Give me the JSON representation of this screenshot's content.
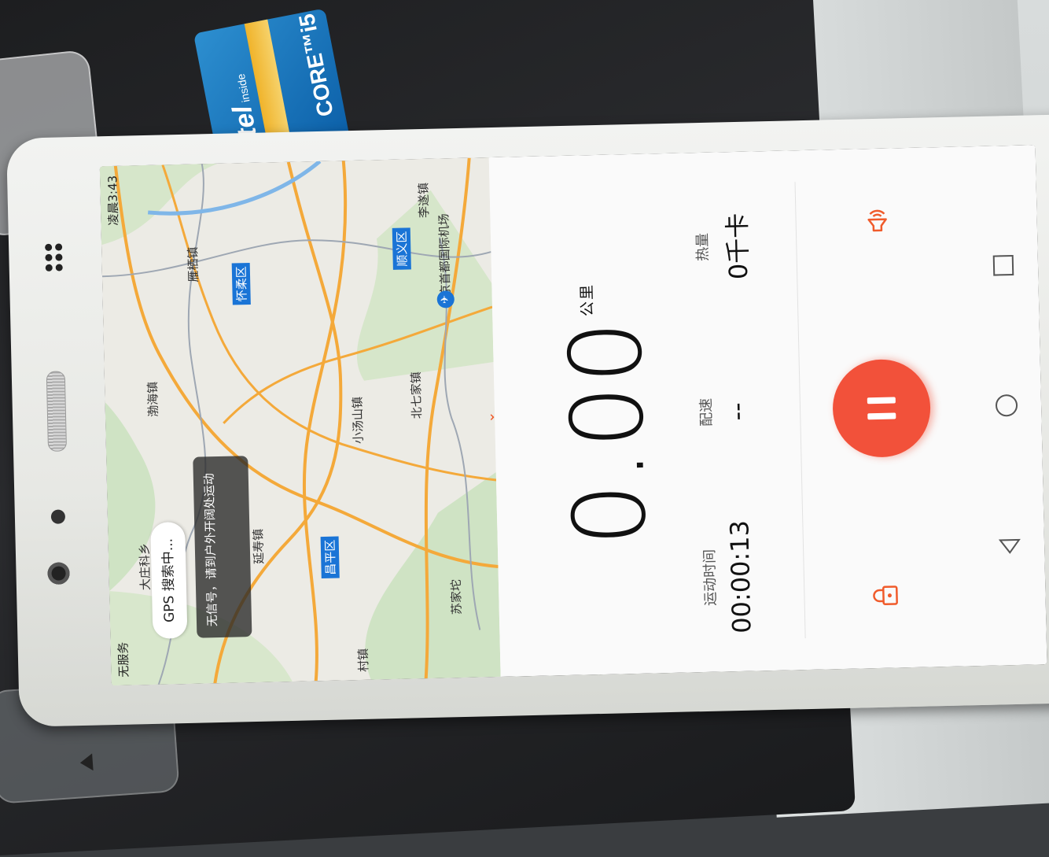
{
  "scene": {
    "sticker": {
      "brand": "intel",
      "tagline": "inside",
      "product": "CORE™i5"
    }
  },
  "status_bar": {
    "carrier": "无服务",
    "time": "凌晨3:43"
  },
  "map": {
    "gps_status": "GPS 搜索中...",
    "no_signal_tip": "无信号，请到户外开阔处运动",
    "places": [
      "大庄科乡",
      "渤海镇",
      "雁栖镇",
      "李遂镇",
      "延寿镇",
      "小汤山镇",
      "北七家镇",
      "苏家坨",
      "北京首都国际机场",
      "村镇"
    ],
    "districts": [
      "怀柔区",
      "顺义区",
      "昌平区"
    ],
    "collapse_icon": "chevron-down-icon"
  },
  "workout": {
    "distance": "0.00",
    "distance_unit": "公里",
    "duration_label": "运动时间",
    "duration": "00:00:13",
    "pace_label": "配速",
    "pace": "--",
    "calories_label": "热量",
    "calories": "0千卡"
  },
  "colors": {
    "accent": "#f2513a",
    "district_badge": "#1a74d6",
    "road": "#f4a93a"
  }
}
